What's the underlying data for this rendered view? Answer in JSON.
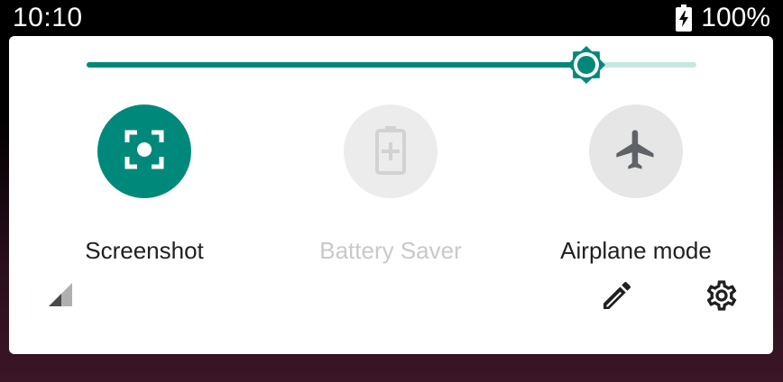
{
  "status_bar": {
    "time": "10:10",
    "battery_percent": "100%",
    "battery_icon": "battery-charging-icon"
  },
  "brightness": {
    "level": 0.82,
    "icon": "brightness-icon",
    "colors": {
      "active": "#00897b",
      "inactive": "#c7e7e1"
    }
  },
  "tiles": [
    {
      "label": "Screenshot",
      "icon": "screenshot-icon",
      "state": "on"
    },
    {
      "label": "Battery Saver",
      "icon": "battery-saver-icon",
      "state": "unavailable"
    },
    {
      "label": "Airplane mode",
      "icon": "airplane-icon",
      "state": "off"
    }
  ],
  "footer": {
    "signal_icon": "signal-icon",
    "edit_icon": "edit-icon",
    "settings_icon": "settings-icon"
  },
  "colors": {
    "accent": "#00897b",
    "tile_off": "#e6e6e6",
    "text": "#202020",
    "text_disabled": "#c9c9c9"
  }
}
